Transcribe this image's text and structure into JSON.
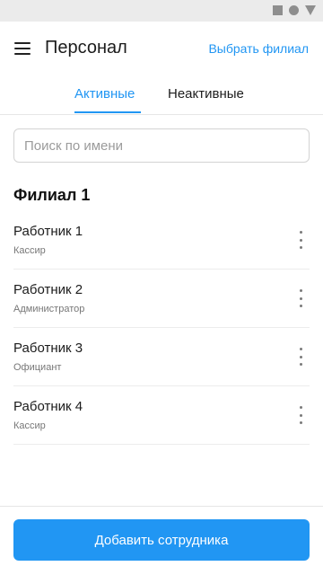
{
  "status_bar": {
    "icons": [
      "square-icon",
      "circle-icon",
      "triangle-icon"
    ]
  },
  "app_bar": {
    "title": "Персонал",
    "select_branch_label": "Выбрать филиал",
    "menu_icon": "hamburger-menu-icon"
  },
  "tabs": [
    {
      "label": "Активные",
      "active": true
    },
    {
      "label": "Неактивные",
      "active": false
    }
  ],
  "search": {
    "placeholder": "Поиск по имени",
    "value": ""
  },
  "branch": {
    "title": "Филиал 1",
    "employees": [
      {
        "name": "Работник 1",
        "role": "Кассир"
      },
      {
        "name": "Работник 2",
        "role": "Администратор"
      },
      {
        "name": "Работник 3",
        "role": "Официант"
      },
      {
        "name": "Работник 4",
        "role": "Кассир"
      }
    ]
  },
  "footer": {
    "add_button_label": "Добавить сотрудника"
  },
  "colors": {
    "accent": "#2196f3",
    "status_bar_bg": "#ebebeb",
    "text_primary": "#1c1c1c",
    "text_secondary": "#777777"
  }
}
